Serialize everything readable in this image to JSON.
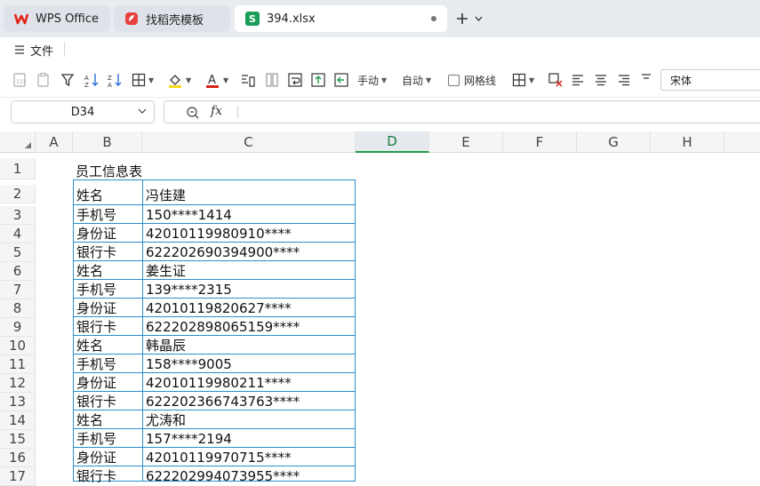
{
  "tabs": {
    "wps": "WPS Office",
    "templates": "找稻壳模板",
    "file": "394.xlsx"
  },
  "menu": {
    "file": "文件"
  },
  "ribbon": {
    "row_height": "手动",
    "col_width": "自动",
    "gridlines": "网格线",
    "font": "宋体"
  },
  "formula_bar": {
    "cell_ref": "D34",
    "fx": "fx",
    "value": ""
  },
  "columns": [
    "A",
    "B",
    "C",
    "D",
    "E",
    "F",
    "G",
    "H"
  ],
  "selected_column": "D",
  "rows": [
    "1",
    "2",
    "3",
    "4",
    "5",
    "6",
    "7",
    "8",
    "9",
    "10",
    "11",
    "12",
    "13",
    "14",
    "15",
    "16",
    "17"
  ],
  "sheet": {
    "title": "员工信息表",
    "records": [
      {
        "label": "姓名",
        "value": "冯佳建"
      },
      {
        "label": "手机号",
        "value": "150****1414"
      },
      {
        "label": "身份证",
        "value": "42010119980910****"
      },
      {
        "label": "银行卡",
        "value": "622202690394900****"
      },
      {
        "label": "姓名",
        "value": "姜生证"
      },
      {
        "label": "手机号",
        "value": "139****2315"
      },
      {
        "label": "身份证",
        "value": "42010119820627****"
      },
      {
        "label": "银行卡",
        "value": "622202898065159****"
      },
      {
        "label": "姓名",
        "value": "韩晶辰"
      },
      {
        "label": "手机号",
        "value": "158****9005"
      },
      {
        "label": "身份证",
        "value": "42010119980211****"
      },
      {
        "label": "银行卡",
        "value": "622202366743763****"
      },
      {
        "label": "姓名",
        "value": "尤涛和"
      },
      {
        "label": "手机号",
        "value": "157****2194"
      },
      {
        "label": "身份证",
        "value": "42010119970715****"
      },
      {
        "label": "银行卡",
        "value": "622202994073955****"
      }
    ]
  },
  "colors": {
    "accent": "#1e9a4a",
    "table_border": "#2a8fce",
    "wps_red": "#e2231a"
  }
}
